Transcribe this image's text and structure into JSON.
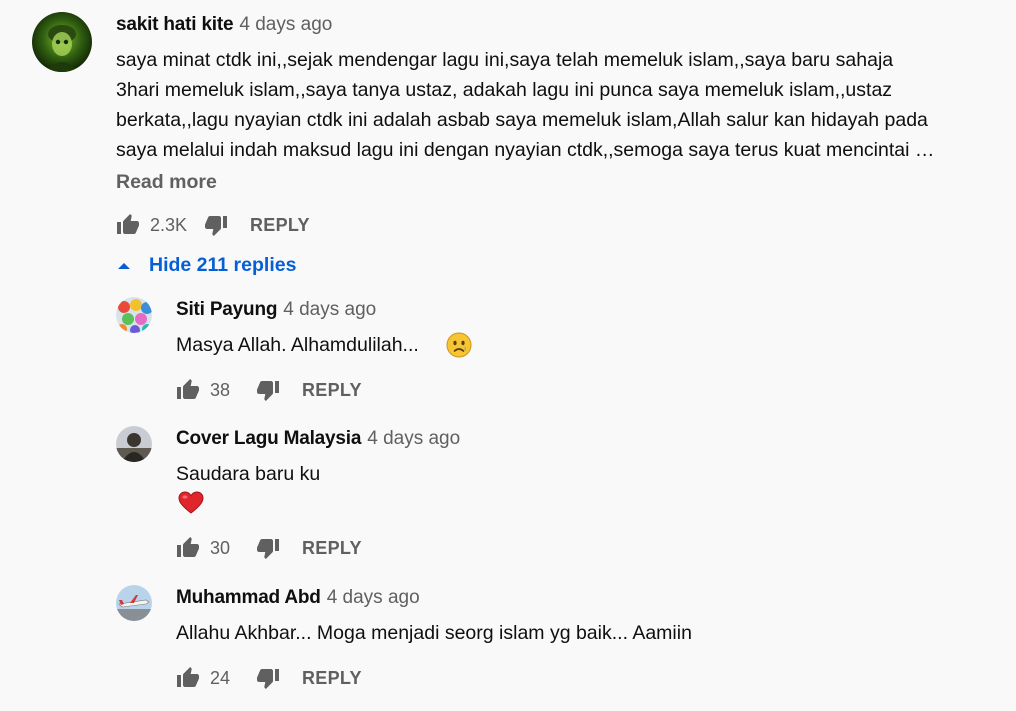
{
  "main_comment": {
    "author": "sakit hati kite",
    "time": "4 days ago",
    "avatar": "soldier-avatar",
    "lines": [
      "saya minat ctdk ini,,sejak mendengar lagu ini,saya telah memeluk islam,,saya baru sahaja",
      "3hari memeluk islam,,saya tanya ustaz, adakah lagu ini punca saya memeluk islam,,ustaz",
      "berkata,,lagu nyayian ctdk ini adalah asbab saya memeluk islam,Allah salur kan hidayah pada",
      "saya melalui indah maksud lagu ini dengan nyayian ctdk,,semoga saya terus kuat mencintai …"
    ],
    "read_more": "Read more",
    "likes": "2.3K",
    "reply_label": "REPLY"
  },
  "replies_toggle": {
    "label": "Hide 211 replies",
    "icon": "caret-up-icon",
    "color": "#065fd4"
  },
  "replies": [
    {
      "author": "Siti Payung",
      "time": "4 days ago",
      "text": "Masya Allah. Alhamdulilah...",
      "emoji": "sad-face-emoji",
      "likes": "38",
      "reply_label": "REPLY"
    },
    {
      "author": "Cover Lagu Malaysia",
      "time": "4 days ago",
      "text": "Saudara baru ku",
      "emoji": "red-heart-emoji",
      "likes": "30",
      "reply_label": "REPLY"
    },
    {
      "author": "Muhammad Abd",
      "time": "4 days ago",
      "text": "Allahu Akhbar... Moga menjadi seorg islam yg baik... Aamiin",
      "likes": "24",
      "reply_label": "REPLY"
    }
  ],
  "colors": {
    "background": "#f9f9f9",
    "secondary_text": "#606060",
    "link_blue": "#065fd4"
  }
}
